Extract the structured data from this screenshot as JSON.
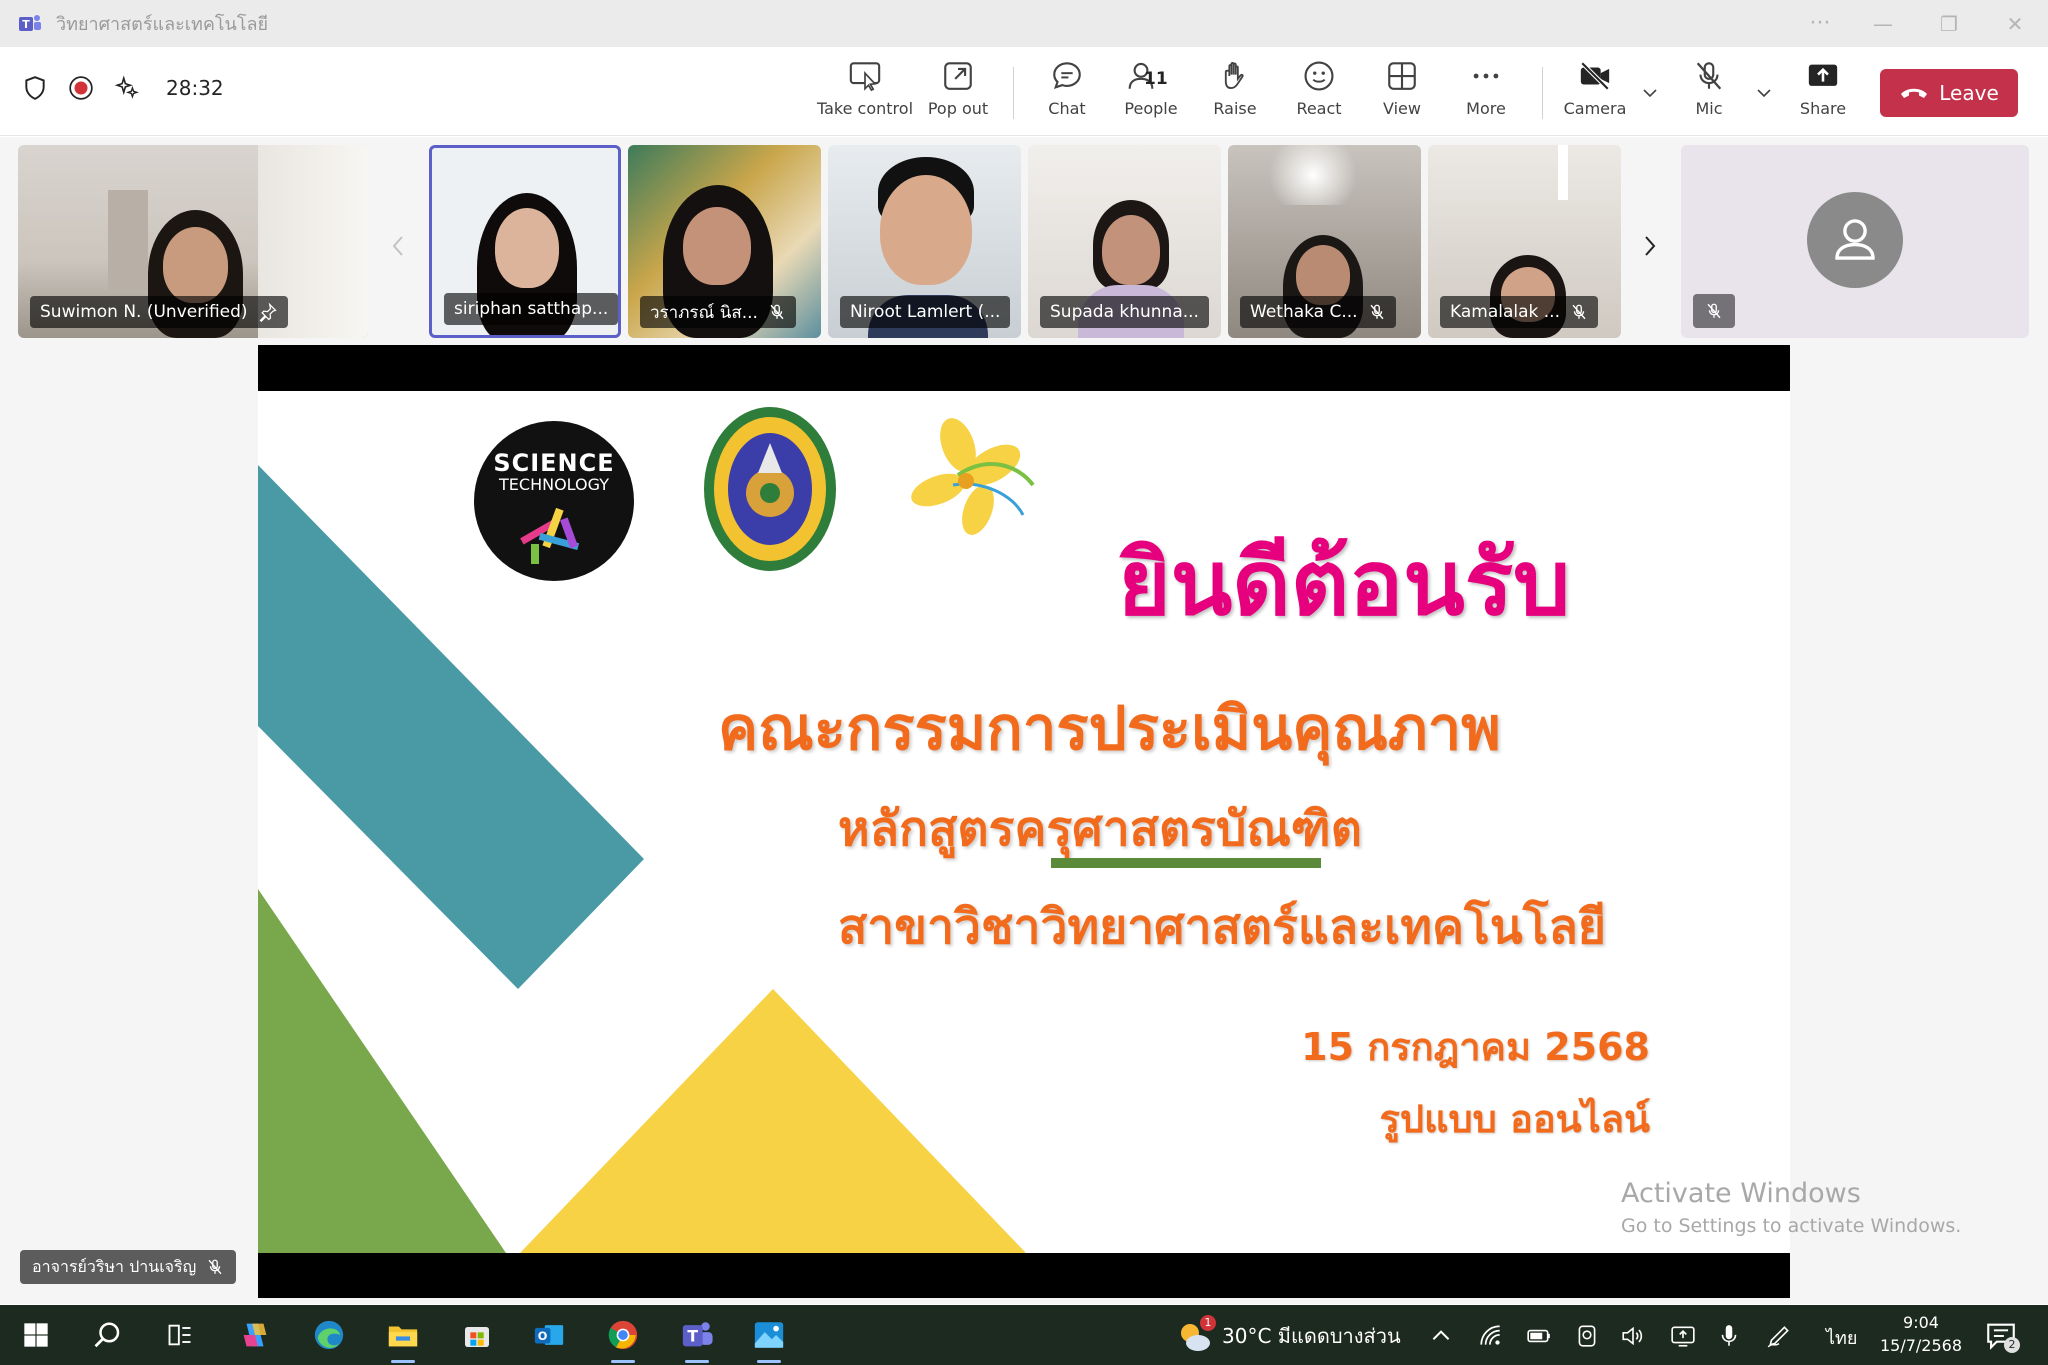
{
  "window": {
    "title": "วิทยาศาสตร์และเทคโนโลยี",
    "controls": [
      "···",
      "—",
      "❐",
      "✕"
    ]
  },
  "toolbar": {
    "timer": "28:32",
    "take_control": "Take control",
    "pop_out": "Pop out",
    "chat": "Chat",
    "people": "People",
    "people_count": "11",
    "raise": "Raise",
    "react": "React",
    "view": "View",
    "more": "More",
    "camera": "Camera",
    "mic": "Mic",
    "share": "Share",
    "leave": "Leave"
  },
  "participants": [
    {
      "name": "Suwimon N. (Unverified)"
    },
    {
      "name": "siriphan satthap..."
    },
    {
      "name": "วราภรณ์ นิส..."
    },
    {
      "name": "Niroot Lamlert (..."
    },
    {
      "name": "Supada khunna..."
    },
    {
      "name": "Wethaka C..."
    },
    {
      "name": "Kamalalak ..."
    }
  ],
  "slide": {
    "logo_text_1": "SCIENCE",
    "logo_text_2": "TECHNOLOGY",
    "welcome": "ยินดีต้อนรับ",
    "line1": "คณะกรรมการประเมินคุณภาพ",
    "line2": "หลักสูตรครุศาสตรบัณฑิต",
    "line3": "สาขาวิชาวิทยาศาสตร์และเทคโนโลยี",
    "date": "15 กรกฎาคม 2568",
    "mode": "รูปแบบ ออนไลน์",
    "colors": {
      "teal": "#4a9aa5",
      "green": "#79a74b",
      "yellow": "#f6d244",
      "pink": "#e6007e",
      "orange": "#f26b1d"
    }
  },
  "presenter": {
    "name": "อาจารย์วริษา ปานเจริญ"
  },
  "watermark": {
    "line1": "Activate Windows",
    "line2": "Go to Settings to activate Windows."
  },
  "taskbar": {
    "weather": "30°C  มีแดดบางส่วน",
    "weather_badge": "1",
    "language": "ไทย",
    "time": "9:04",
    "date": "15/7/2568",
    "notifications": "2"
  }
}
